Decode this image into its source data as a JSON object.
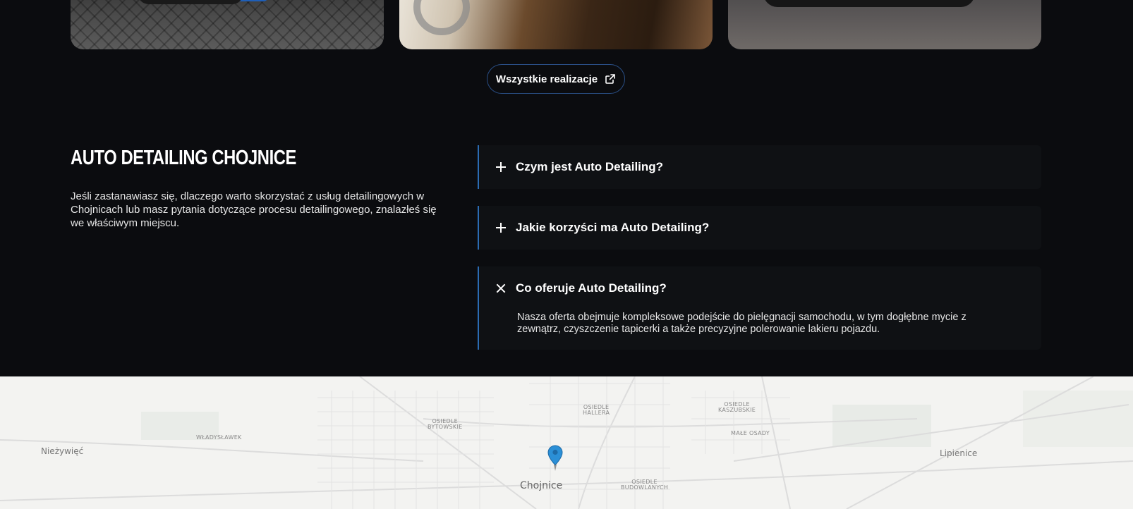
{
  "gallery": {
    "images": [
      "car-exterior-blue",
      "car-interior-leather",
      "car-dark-parked"
    ]
  },
  "cta": {
    "label": "Wszystkie realizacje",
    "icon": "external-link-icon"
  },
  "faq": {
    "title": "AUTO DETAILING CHOJNICE",
    "description": "Jeśli zastanawiasz się, dlaczego warto skorzystać z usług detailingowych w Chojnicach lub masz pytania dotyczące procesu detailingowego, znalazłeś się we właściwym miejscu.",
    "items": [
      {
        "question": "Czym jest Auto Detailing?",
        "expanded": false,
        "icon": "plus-icon"
      },
      {
        "question": "Jakie korzyści ma Auto Detailing?",
        "expanded": false,
        "icon": "plus-icon"
      },
      {
        "question": "Co oferuje Auto Detailing?",
        "expanded": true,
        "icon": "close-icon",
        "answer": "Nasza oferta obejmuje kompleksowe podejście do pielęgnacji samochodu, w tym dogłębne mycie z zewnątrz, czyszczenie tapicerki a także precyzyjne polerowanie lakieru pojazdu."
      }
    ]
  },
  "map": {
    "labels": {
      "niezywiec": "Nieżywięć",
      "wladyslawek": "WŁADYSŁAWEK",
      "bytowskie_1": "OSIEDLE",
      "bytowskie_2": "BYTOWSKIE",
      "hallera_1": "OSIEDLE",
      "hallera_2": "HALLERA",
      "kaszubskie_1": "OSIEDLE",
      "kaszubskie_2": "KASZUBSKIE",
      "male_osady": "MAŁE OSADY",
      "lipienice": "Lipienice",
      "chojnice": "Chojnice",
      "budowlanych_1": "OSIEDLE",
      "budowlanych_2": "BUDOWLANYCH"
    },
    "pin_color": "#2b8fd6"
  },
  "colors": {
    "accent": "#2b6cb3",
    "background": "#0b0c0f"
  }
}
